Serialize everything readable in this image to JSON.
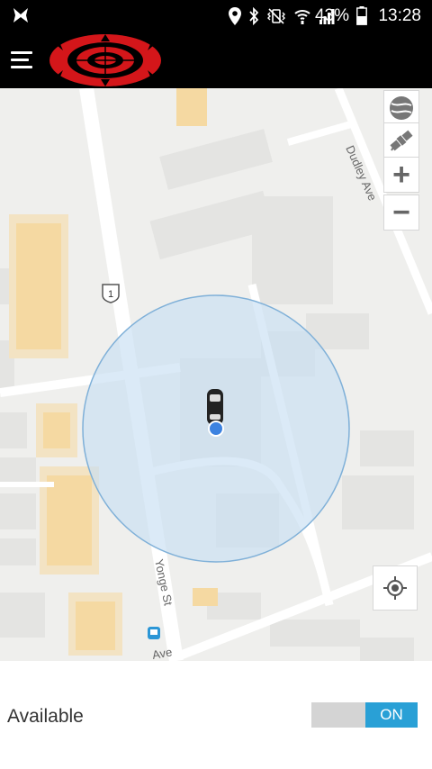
{
  "status_bar": {
    "battery": "43%",
    "time": "13:28",
    "icons": [
      "location-pin-icon",
      "bluetooth-icon",
      "vibrate-icon",
      "wifi-icon",
      "signal-icon",
      "battery-icon"
    ]
  },
  "app_bar": {
    "menu_icon": "hamburger-menu-icon",
    "logo": "red-mandala-logo"
  },
  "map": {
    "labels": {
      "dudley": "Dudley Ave",
      "yonge": "Yonge St",
      "route": "1",
      "partial_ave": "Ave"
    },
    "controls": [
      "compass-icon",
      "satellite-icon",
      "zoom-in",
      "zoom-out"
    ],
    "zoom_in": "+",
    "zoom_out": "−",
    "marker": "car-icon",
    "colors": {
      "road": "#ffffff",
      "building": "#e2e2e0",
      "highlight": "#f5dfb2",
      "accuracy": "#cfe1ef",
      "dot": "#3c82e0"
    }
  },
  "availability": {
    "label": "Available",
    "toggle_text": "ON",
    "on": true
  }
}
